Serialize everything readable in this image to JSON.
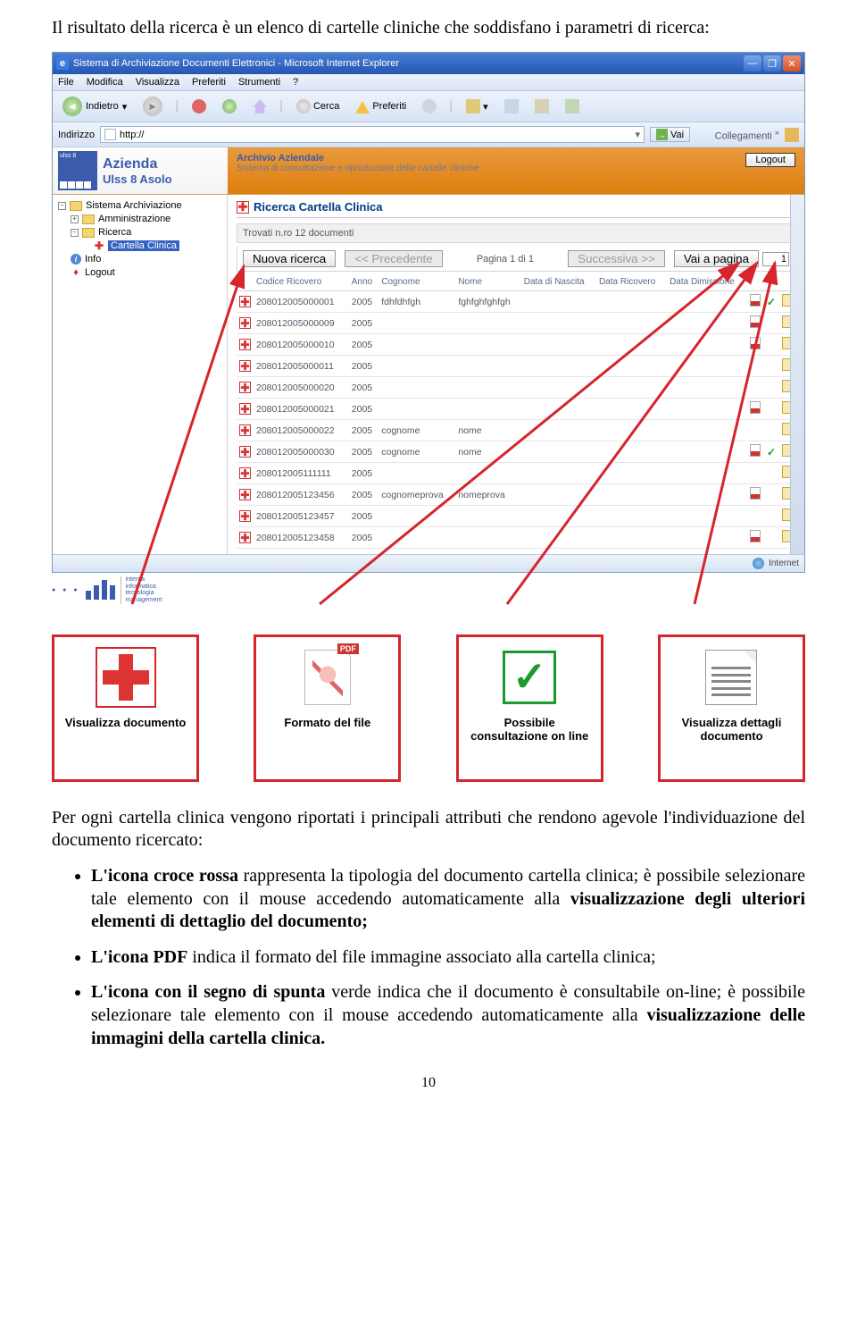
{
  "intro": "Il risultato della ricerca è un elenco di cartelle cliniche che soddisfano i parametri di ricerca:",
  "ie": {
    "title": "Sistema di Archiviazione Documenti Elettronici - Microsoft Internet Explorer",
    "menus": [
      "File",
      "Modifica",
      "Visualizza",
      "Preferiti",
      "Strumenti",
      "?"
    ],
    "toolbar": {
      "back": "Indietro",
      "search": "Cerca",
      "favs": "Preferiti"
    },
    "address_label": "Indirizzo",
    "address_value": "http://",
    "go": "Vai",
    "links": "Collegamenti",
    "status": "Internet"
  },
  "app": {
    "brand_top": "Azienda",
    "brand_bottom": "Ulss 8 Asolo",
    "brand_badge": "ulss 8",
    "header_title": "Archivio Aziendale",
    "header_sub": "Sistema di consultazione e riproduzione delle cartelle cliniche",
    "logout": "Logout",
    "tree": {
      "root": "Sistema Archiviazione",
      "admin": "Amministrazione",
      "search": "Ricerca",
      "cartella": "Cartella Clinica",
      "info": "Info",
      "logout": "Logout"
    },
    "panel_title": "Ricerca Cartella Clinica",
    "found": "Trovati n.ro 12 documenti",
    "btn_new": "Nuova ricerca",
    "btn_prev": "<< Precedente",
    "page": "Pagina 1 di 1",
    "btn_next": "Successiva >>",
    "btn_goto": "Vai a pagina",
    "page_val": "1",
    "cols": [
      "Codice Ricovero",
      "Anno",
      "Cognome",
      "Nome",
      "Data di Nascita",
      "Data Ricovero",
      "Data Dimissione"
    ],
    "rows": [
      {
        "code": "208012005000001",
        "anno": "2005",
        "cog": "fdhfdhfgh",
        "nome": "fghfghfghfgh",
        "pdf": true,
        "ok": true,
        "doc": true
      },
      {
        "code": "208012005000009",
        "anno": "2005",
        "cog": "",
        "nome": "",
        "pdf": true,
        "ok": false,
        "doc": true
      },
      {
        "code": "208012005000010",
        "anno": "2005",
        "cog": "",
        "nome": "",
        "pdf": true,
        "ok": false,
        "doc": true
      },
      {
        "code": "208012005000011",
        "anno": "2005",
        "cog": "",
        "nome": "",
        "pdf": false,
        "ok": false,
        "doc": true
      },
      {
        "code": "208012005000020",
        "anno": "2005",
        "cog": "",
        "nome": "",
        "pdf": false,
        "ok": false,
        "doc": true
      },
      {
        "code": "208012005000021",
        "anno": "2005",
        "cog": "",
        "nome": "",
        "pdf": true,
        "ok": false,
        "doc": true
      },
      {
        "code": "208012005000022",
        "anno": "2005",
        "cog": "cognome",
        "nome": "nome",
        "pdf": false,
        "ok": false,
        "doc": true
      },
      {
        "code": "208012005000030",
        "anno": "2005",
        "cog": "cognome",
        "nome": "nome",
        "pdf": true,
        "ok": true,
        "doc": true
      },
      {
        "code": "208012005111111",
        "anno": "2005",
        "cog": "",
        "nome": "",
        "pdf": false,
        "ok": false,
        "doc": true
      },
      {
        "code": "208012005123456",
        "anno": "2005",
        "cog": "cognomeprova",
        "nome": "nomeprova",
        "pdf": true,
        "ok": false,
        "doc": true
      },
      {
        "code": "208012005123457",
        "anno": "2005",
        "cog": "",
        "nome": "",
        "pdf": false,
        "ok": false,
        "doc": true
      },
      {
        "code": "208012005123458",
        "anno": "2005",
        "cog": "",
        "nome": "",
        "pdf": true,
        "ok": false,
        "doc": true
      }
    ]
  },
  "callouts": [
    {
      "caption": "Visualizza documento"
    },
    {
      "caption": "Formato del file"
    },
    {
      "caption": "Possibile consultazione on line"
    },
    {
      "caption": "Visualizza dettagli documento"
    }
  ],
  "body": {
    "p1": "Per ogni cartella clinica vengono riportati i principali attributi che rendono agevole l'individuazione del documento ricercato:",
    "li1a": "L'icona croce rossa",
    "li1b": " rappresenta la tipologia del documento cartella clinica; è possibile selezionare tale elemento con il mouse accedendo automaticamente alla ",
    "li1c": "visualizzazione degli ulteriori elementi di dettaglio del documento;",
    "li2a": "L'icona PDF",
    "li2b": " indica il formato del file immagine associato alla cartella clinica;",
    "li3a": "L'icona con il segno di spunta",
    "li3b": " verde indica che il documento è consultabile on-line; è possibile selezionare tale elemento con il mouse accedendo automaticamente alla ",
    "li3c": "visualizzazione delle immagini della cartella clinica."
  },
  "page_number": "10"
}
